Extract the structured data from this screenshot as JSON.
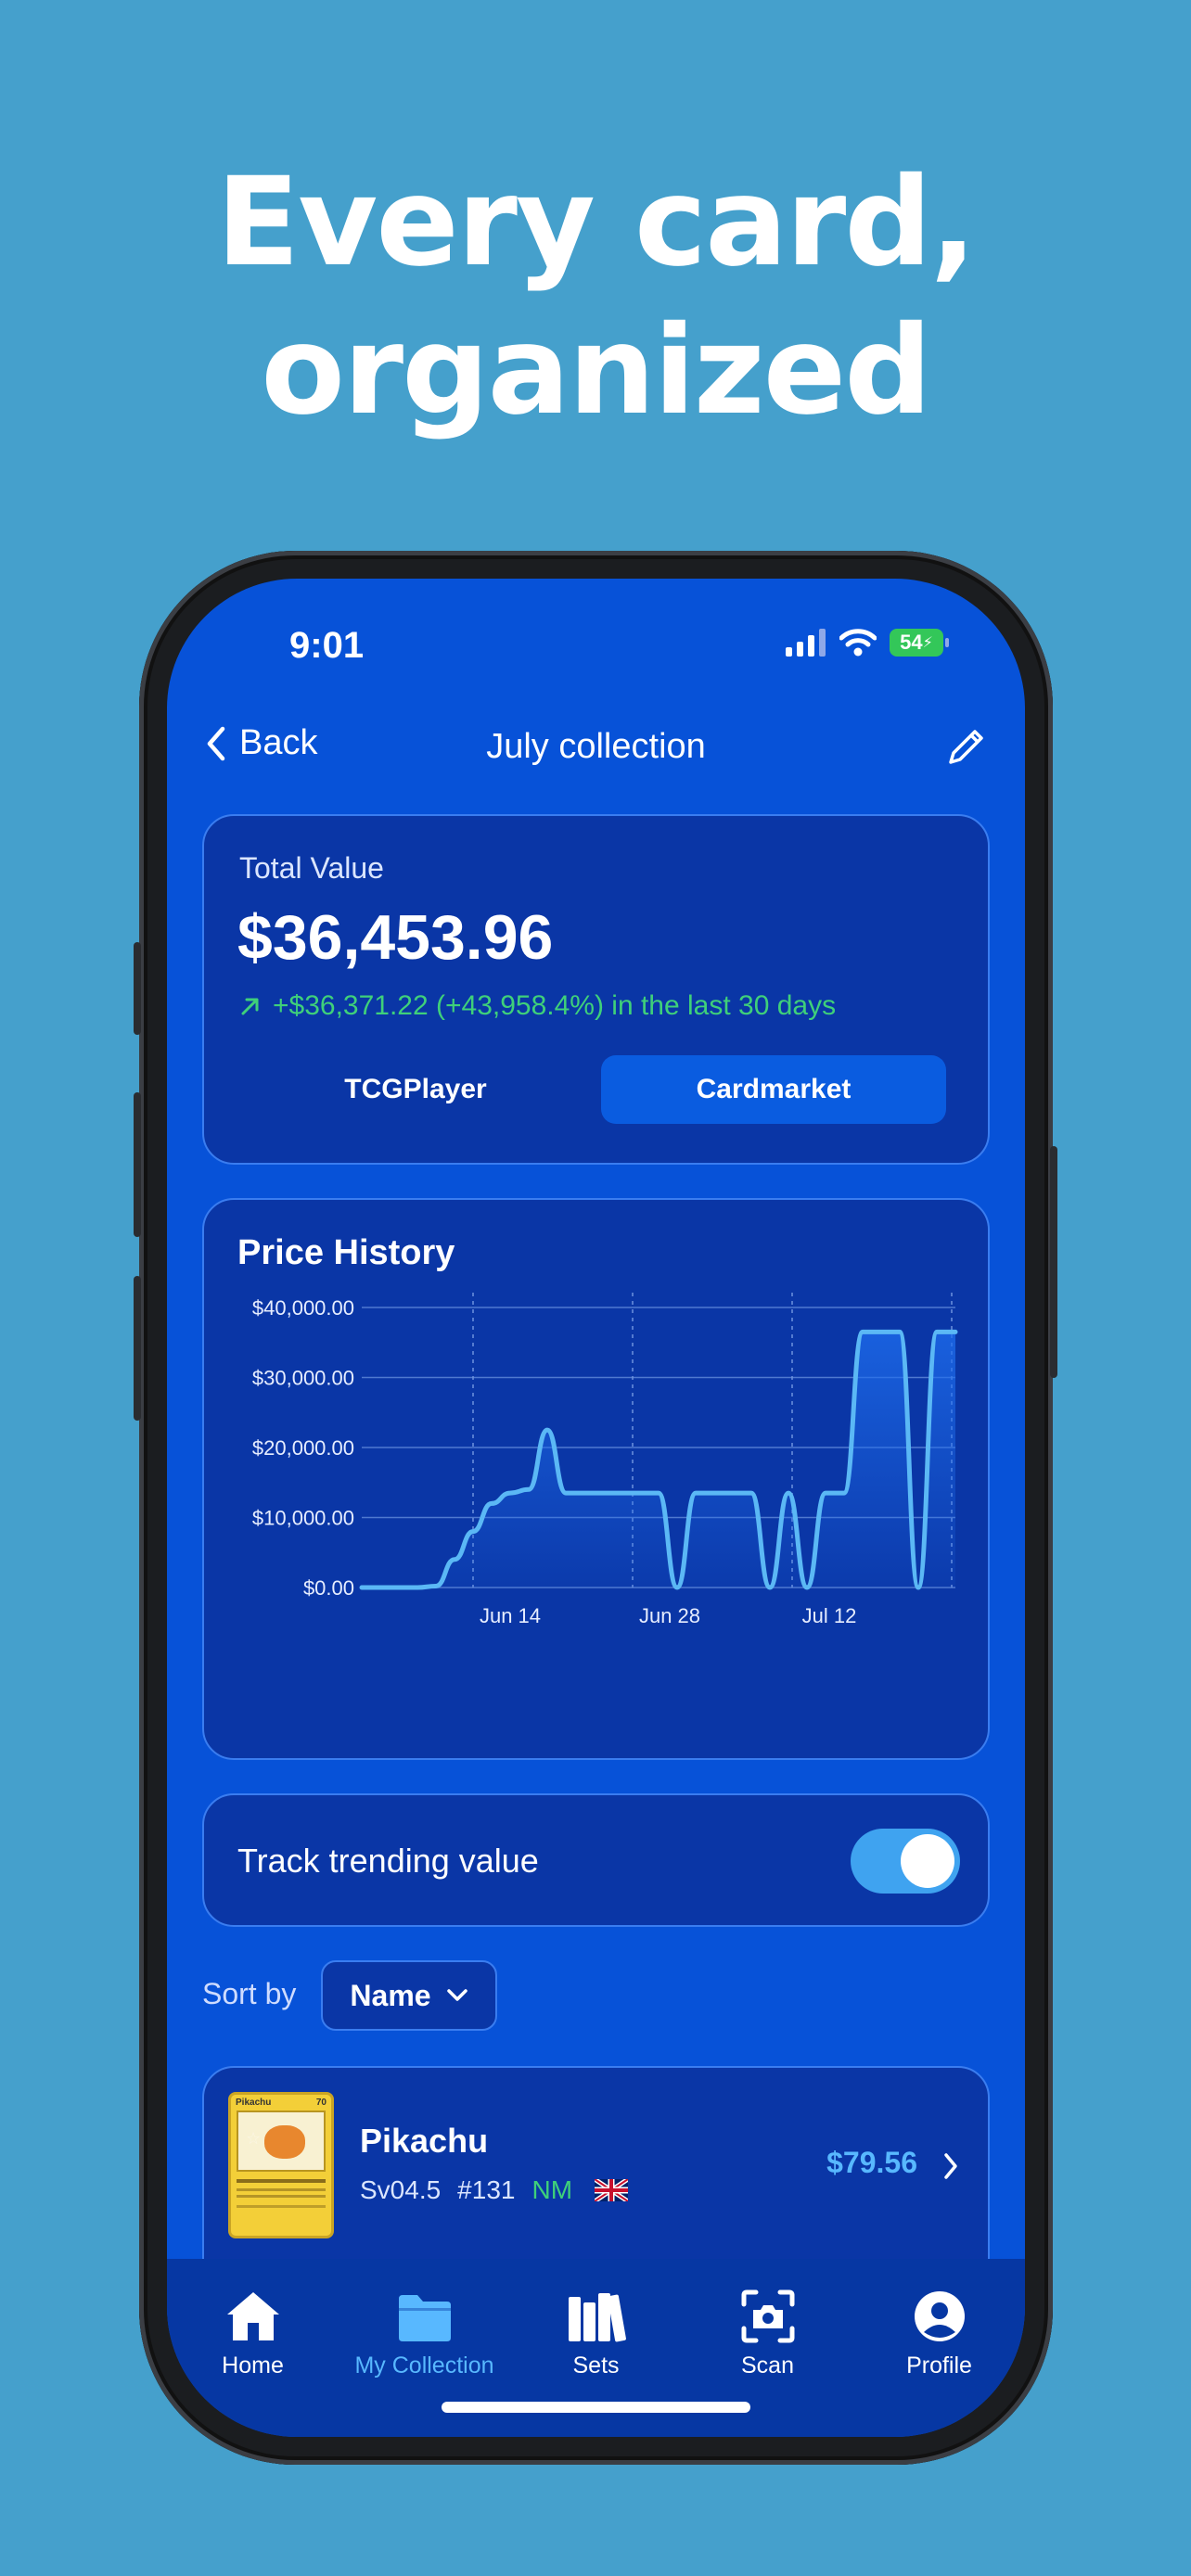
{
  "headline": {
    "line1": "Every card,",
    "line2": "organized"
  },
  "status": {
    "time": "9:01",
    "battery": "54"
  },
  "nav": {
    "back_label": "Back",
    "title": "July collection"
  },
  "total": {
    "label": "Total Value",
    "value": "$36,453.96",
    "change": "+$36,371.22 (+43,958.4%) in the last 30 days",
    "sources": [
      "TCGPlayer",
      "Cardmarket"
    ],
    "active_source": "Cardmarket"
  },
  "price_history": {
    "title": "Price History"
  },
  "chart_data": {
    "type": "line",
    "title": "Price History",
    "yticks": [
      "$40,000.00",
      "$30,000.00",
      "$20,000.00",
      "$10,000.00",
      "$0.00"
    ],
    "xticks": [
      "Jun 14",
      "Jun 28",
      "Jul 12"
    ],
    "ylim": [
      0,
      40000
    ],
    "grid": true,
    "series": [
      {
        "values": [
          0,
          0,
          0,
          0,
          200,
          4000,
          8000,
          12000,
          13500,
          14000,
          22500,
          13500,
          13500,
          13500,
          13500,
          13500,
          13500,
          0,
          13500,
          13500,
          13500,
          13500,
          0,
          13500,
          0,
          13500,
          13500,
          36500,
          36500,
          36500,
          0,
          36500,
          36500
        ]
      }
    ]
  },
  "trending": {
    "label": "Track trending value",
    "enabled": true
  },
  "sort": {
    "label": "Sort by",
    "value": "Name"
  },
  "cards": [
    {
      "name": "Pikachu",
      "set": "Sv04.5",
      "number": "#131",
      "condition": "NM",
      "price": "$79.56",
      "thumb_title": "Pikachu",
      "thumb_hp": "70"
    }
  ],
  "tabs": [
    {
      "label": "Home",
      "icon": "house-icon",
      "active": false
    },
    {
      "label": "My Collection",
      "icon": "folder-icon",
      "active": true
    },
    {
      "label": "Sets",
      "icon": "books-icon",
      "active": false
    },
    {
      "label": "Scan",
      "icon": "camera-icon",
      "active": false
    },
    {
      "label": "Profile",
      "icon": "person-icon",
      "active": false
    }
  ],
  "colors": {
    "background": "#45a0cc",
    "screen": "#0752d8",
    "card": "#0a36a6",
    "accent": "#58b8ff",
    "positive": "#3fd07a",
    "active_tab": "#58b8ff"
  }
}
